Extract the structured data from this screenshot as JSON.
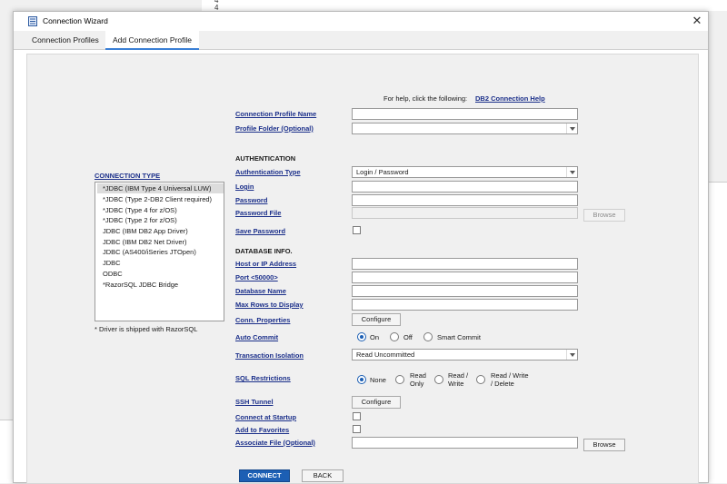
{
  "background": {
    "lines": [
      "4",
      "4"
    ]
  },
  "window": {
    "title": "Connection Wizard",
    "close_glyph": "✕"
  },
  "tabs": [
    {
      "label": "Connection Profiles",
      "active": false
    },
    {
      "label": "Add Connection Profile",
      "active": true
    }
  ],
  "help": {
    "text": "For help, click the following:",
    "link": "DB2 Connection Help"
  },
  "profile": {
    "name_label": "Connection Profile Name",
    "name_value": "",
    "folder_label": "Profile Folder (Optional)",
    "folder_value": ""
  },
  "connection_type": {
    "label": "CONNECTION TYPE",
    "items": [
      {
        "label": "*JDBC (IBM Type 4 Universal LUW)",
        "selected": true
      },
      {
        "label": "*JDBC (Type 2-DB2 Client required)",
        "selected": false
      },
      {
        "label": "*JDBC (Type 4 for z/OS)",
        "selected": false
      },
      {
        "label": "*JDBC (Type 2 for z/OS)",
        "selected": false
      },
      {
        "label": "JDBC (IBM DB2 App Driver)",
        "selected": false
      },
      {
        "label": "JDBC (IBM DB2 Net Driver)",
        "selected": false
      },
      {
        "label": "JDBC (AS400/iSeries JTOpen)",
        "selected": false
      },
      {
        "label": "JDBC",
        "selected": false
      },
      {
        "label": "ODBC",
        "selected": false
      },
      {
        "label": "*RazorSQL JDBC Bridge",
        "selected": false
      }
    ],
    "footnote": "* Driver is shipped with RazorSQL"
  },
  "authentication": {
    "heading": "AUTHENTICATION",
    "type_label": "Authentication Type",
    "type_value": "Login / Password",
    "login_label": "Login",
    "password_label": "Password",
    "password_file_label": "Password File",
    "browse_label": "Browse",
    "save_password_label": "Save Password"
  },
  "database": {
    "heading": "DATABASE INFO.",
    "host_label": "Host or IP Address",
    "port_label": "Port <50000>",
    "dbname_label": "Database Name",
    "maxrows_label": "Max Rows to Display",
    "conn_props_label": "Conn. Properties",
    "configure_label": "Configure",
    "auto_commit_label": "Auto Commit",
    "auto_commit_options": [
      "On",
      "Off",
      "Smart Commit"
    ],
    "isolation_label": "Transaction Isolation",
    "isolation_value": "Read Uncommitted",
    "sql_restrictions_label": "SQL Restrictions",
    "sql_options": [
      "None",
      "Read\nOnly",
      "Read /\nWrite",
      "Read / Write\n/ Delete"
    ],
    "ssh_label": "SSH Tunnel",
    "ssh_configure_label": "Configure",
    "startup_label": "Connect at Startup",
    "favorites_label": "Add to Favorites",
    "assoc_file_label": "Associate File (Optional)",
    "assoc_browse_label": "Browse"
  },
  "actions": {
    "connect": "CONNECT",
    "back": "BACK"
  },
  "colors": {
    "accent": "#1c5fb4",
    "link": "#1b2f8a"
  }
}
